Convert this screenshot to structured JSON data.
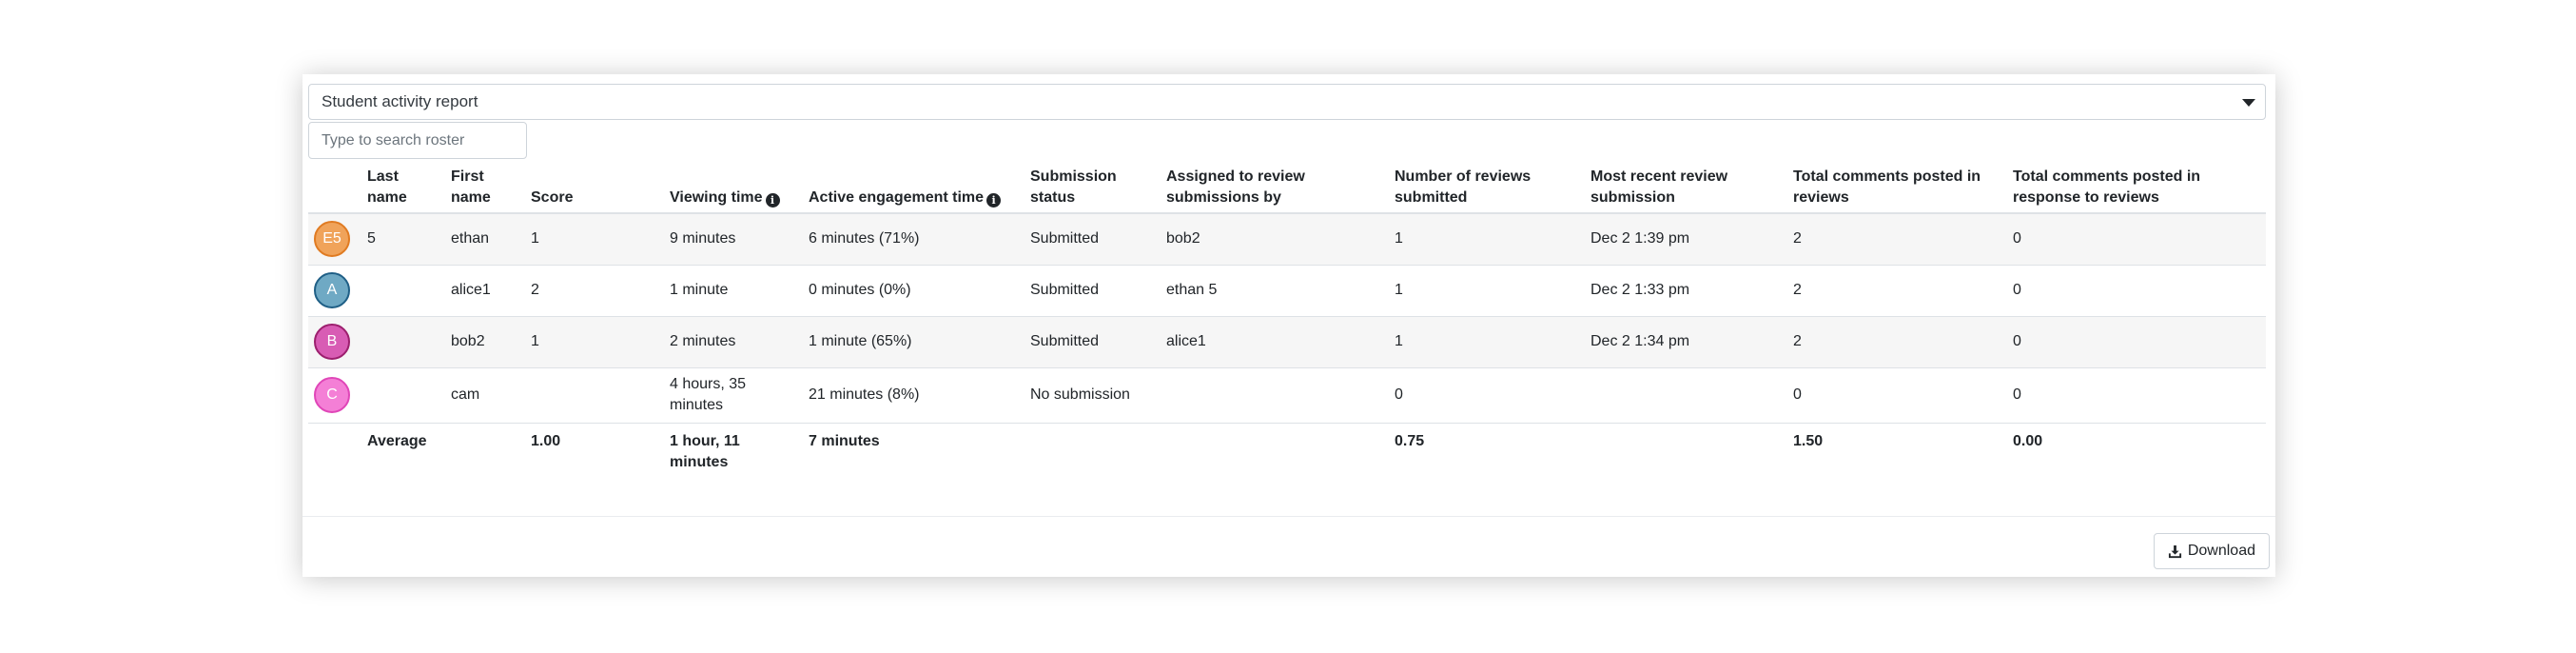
{
  "report_select": {
    "label": "Student activity report"
  },
  "search": {
    "placeholder": "Type to search roster"
  },
  "table": {
    "headers": {
      "last_name": "Last name",
      "first_name": "First name",
      "score": "Score",
      "viewing_time": "Viewing time",
      "active_engagement_time": "Active engagement time",
      "submission_status": "Submission status",
      "assigned_to_review": "Assigned to review submissions by",
      "reviews_submitted": "Number of reviews submitted",
      "recent_review": "Most recent review submission",
      "comments_in_reviews": "Total comments posted in reviews",
      "comments_in_response": "Total comments posted in response to reviews"
    },
    "rows": [
      {
        "avatar": "E5",
        "avatar_color": "#f0a35a",
        "avatar_border": "#e07b22",
        "last_name": "5",
        "first_name": "ethan",
        "score": "1",
        "viewing_time": "9 minutes",
        "active_engagement_time": "6 minutes (71%)",
        "submission_status": "Submitted",
        "assigned_to_review": "bob2",
        "reviews_submitted": "1",
        "recent_review": "Dec 2 1:39 pm",
        "comments_in_reviews": "2",
        "comments_in_response": "0"
      },
      {
        "avatar": "A",
        "avatar_color": "#6fa9c4",
        "avatar_border": "#1f5f86",
        "last_name": "",
        "first_name": "alice1",
        "score": "2",
        "viewing_time": "1 minute",
        "active_engagement_time": "0 minutes (0%)",
        "submission_status": "Submitted",
        "assigned_to_review": "ethan 5",
        "reviews_submitted": "1",
        "recent_review": "Dec 2 1:33 pm",
        "comments_in_reviews": "2",
        "comments_in_response": "0"
      },
      {
        "avatar": "B",
        "avatar_color": "#d85cb4",
        "avatar_border": "#9c1f6e",
        "last_name": "",
        "first_name": "bob2",
        "score": "1",
        "viewing_time": "2 minutes",
        "active_engagement_time": "1 minute (65%)",
        "submission_status": "Submitted",
        "assigned_to_review": "alice1",
        "reviews_submitted": "1",
        "recent_review": "Dec 2 1:34 pm",
        "comments_in_reviews": "2",
        "comments_in_response": "0"
      },
      {
        "avatar": "C",
        "avatar_color": "#f47fd6",
        "avatar_border": "#e046b8",
        "last_name": "",
        "first_name": "cam",
        "score": "",
        "viewing_time": "4 hours, 35 minutes",
        "active_engagement_time": "21 minutes (8%)",
        "submission_status": "No submission",
        "assigned_to_review": "",
        "reviews_submitted": "0",
        "recent_review": "",
        "comments_in_reviews": "0",
        "comments_in_response": "0"
      }
    ],
    "average": {
      "label": "Average",
      "score": "1.00",
      "viewing_time": "1 hour, 11 minutes",
      "active_engagement_time": "7 minutes",
      "reviews_submitted": "0.75",
      "comments_in_reviews": "1.50",
      "comments_in_response": "0.00"
    }
  },
  "footer": {
    "download_label": "Download"
  },
  "icons": {
    "info": "info-icon",
    "caret": "caret-down-icon",
    "download": "download-icon"
  }
}
